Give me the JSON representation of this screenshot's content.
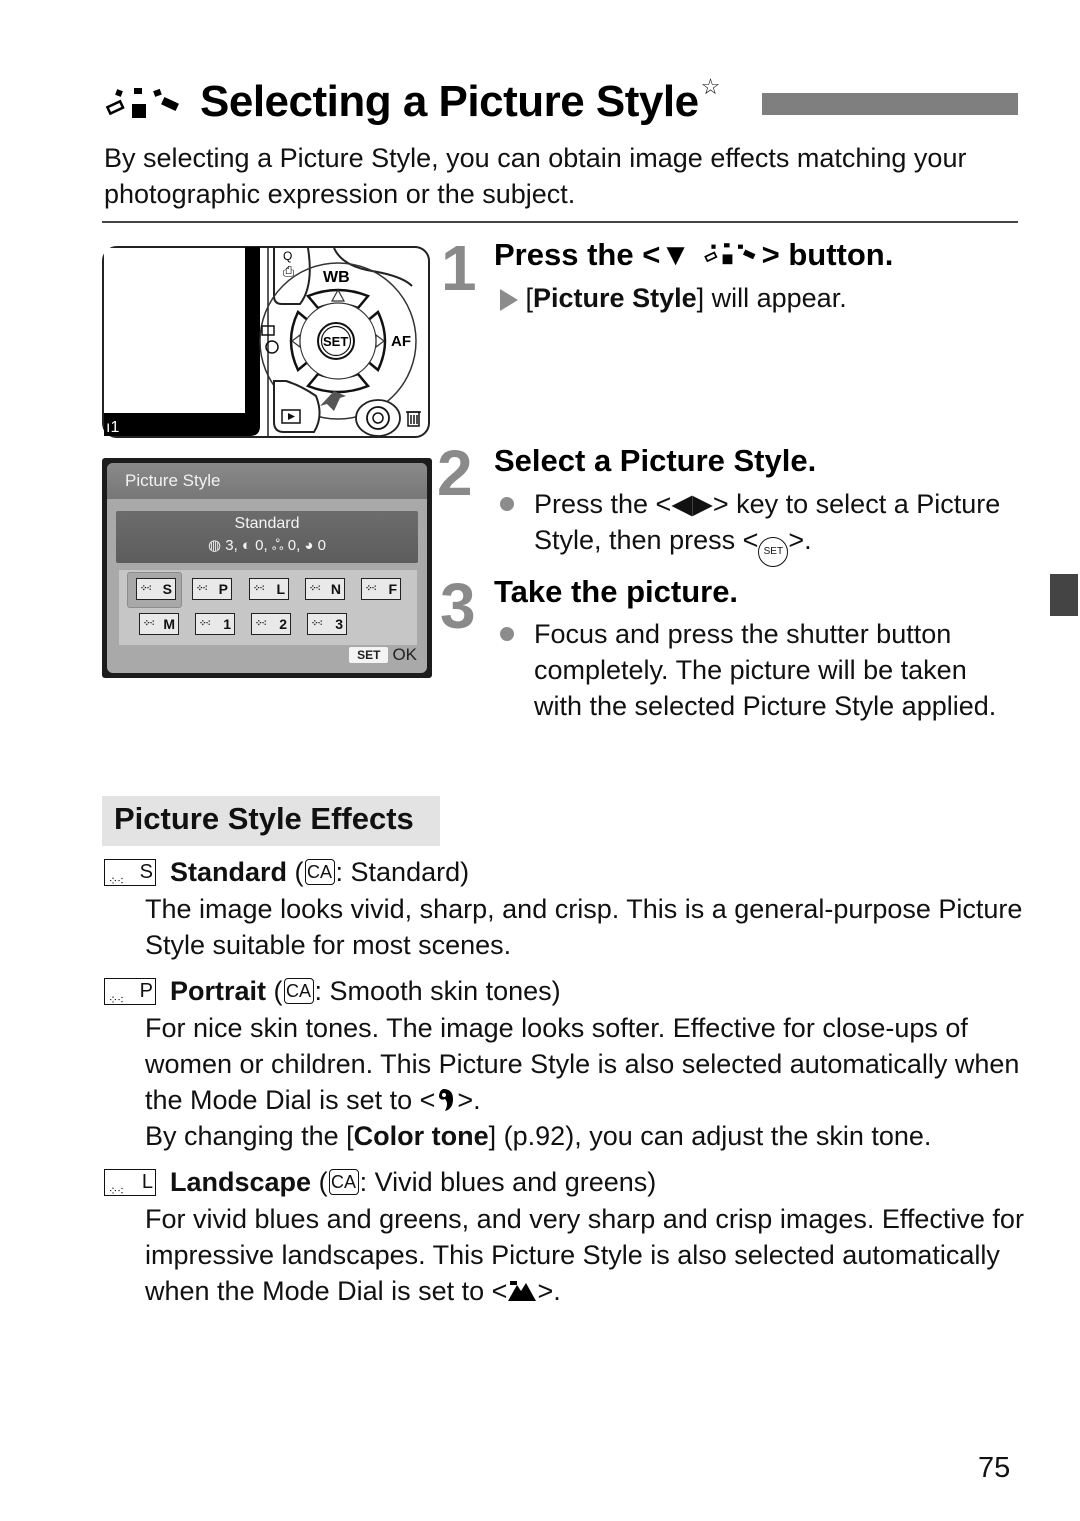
{
  "page": {
    "title": "Selecting a Picture Style",
    "title_star": "☆",
    "intro": "By selecting a Picture Style, you can obtain image effects matching your photographic expression or the subject.",
    "page_number": "75"
  },
  "camera_diagram": {
    "labels": {
      "wb": "WB",
      "af": "AF",
      "set": "SET"
    }
  },
  "lcd_screen": {
    "header": "Picture Style",
    "selected_style": "Standard",
    "params": "◍ 3, ◐ 0, ஃ 0, ◕ 0",
    "styles_row1": [
      "S",
      "P",
      "L",
      "N",
      "F"
    ],
    "styles_row2": [
      "M",
      "1",
      "2",
      "3"
    ],
    "selected_index": 0,
    "set_label": "SET",
    "ok_label": "OK"
  },
  "steps": [
    {
      "number": "1",
      "title_prefix": "Press the <",
      "title_symbol": "▼",
      "title_suffix": "> button.",
      "lines": [
        {
          "bold": "Picture Style",
          "prefix": "[",
          "suffix": "] will appear."
        }
      ]
    },
    {
      "number": "2",
      "title": "Select a Picture Style.",
      "text_prefix": "Press the <",
      "text_keys": "◀▶",
      "text_middle": "> key to select a Picture Style, then press <",
      "text_set": "SET",
      "text_suffix": ">."
    },
    {
      "number": "3",
      "title": "Take the picture.",
      "text": "Focus and press the shutter button completely. The picture will be taken with the selected Picture Style applied."
    }
  ],
  "effects": {
    "heading": "Picture Style Effects",
    "ca_label": "CA",
    "items": [
      {
        "icon_letter": "S",
        "name": "Standard",
        "ca_desc": ": Standard)",
        "desc": "The image looks vivid, sharp, and crisp. This is a general-purpose Picture Style suitable for most scenes."
      },
      {
        "icon_letter": "P",
        "name": "Portrait",
        "ca_desc": ": Smooth skin tones)",
        "desc": "For nice skin tones. The image looks softer. Effective for close-ups of women or children. This Picture Style is also selected automatically when the Mode Dial is set to <",
        "desc_mode_icon": "portrait-mode",
        "desc_after": ">.",
        "extra_prefix": "By changing the [",
        "extra_bold": "Color tone",
        "extra_suffix": "] (p.92), you can adjust the skin tone."
      },
      {
        "icon_letter": "L",
        "name": "Landscape",
        "ca_desc": ": Vivid blues and greens)",
        "desc": "For vivid blues and greens, and very sharp and crisp images. Effective for impressive landscapes. This Picture Style is also selected automatically when the Mode Dial is set to <",
        "desc_mode_icon": "landscape-mode",
        "desc_after": ">."
      }
    ]
  }
}
